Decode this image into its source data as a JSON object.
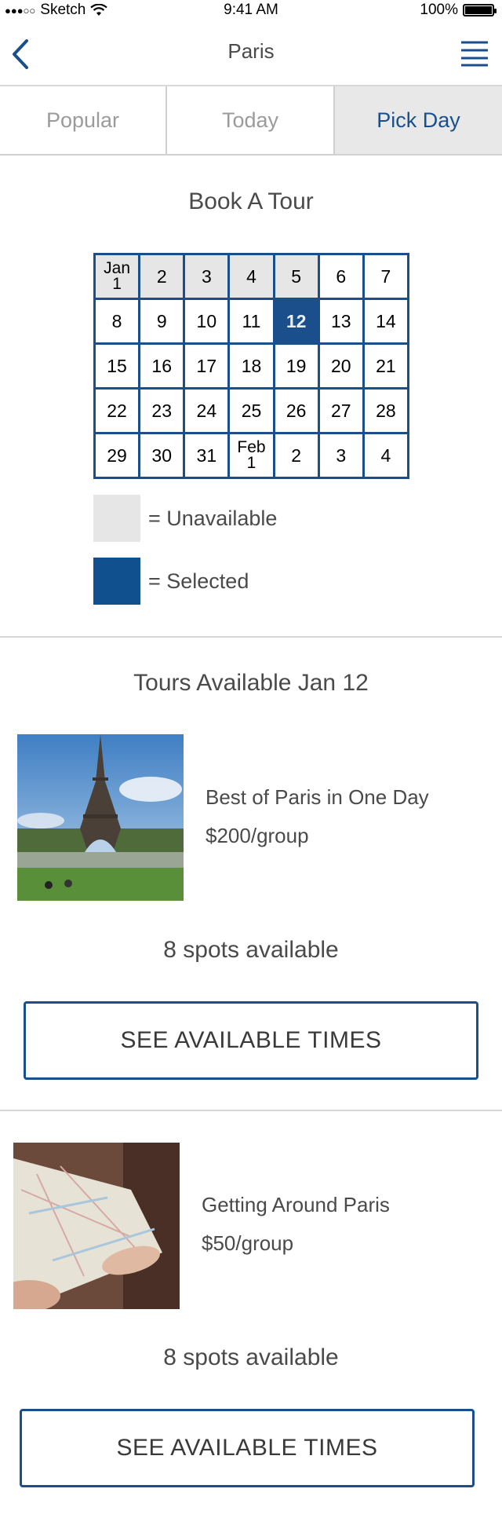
{
  "status": {
    "carrier": "Sketch",
    "time": "9:41 AM",
    "battery": "100%"
  },
  "nav": {
    "title": "Paris"
  },
  "tabs": [
    {
      "label": "Popular"
    },
    {
      "label": "Today"
    },
    {
      "label": "Pick Day",
      "active": true
    }
  ],
  "booking": {
    "title": "Book A Tour",
    "calendar": [
      [
        "Jan\n1",
        "2",
        "3",
        "4",
        "5",
        "6",
        "7"
      ],
      [
        "8",
        "9",
        "10",
        "11",
        "12",
        "13",
        "14"
      ],
      [
        "15",
        "16",
        "17",
        "18",
        "19",
        "20",
        "21"
      ],
      [
        "22",
        "23",
        "24",
        "25",
        "26",
        "27",
        "28"
      ],
      [
        "29",
        "30",
        "31",
        "Feb\n1",
        "2",
        "3",
        "4"
      ]
    ],
    "unavailable": [
      "Jan\n1",
      "2",
      "3",
      "4",
      "5"
    ],
    "selected": "12",
    "legend": {
      "unavailable": "= Unavailable",
      "selected": "= Selected"
    }
  },
  "tours": {
    "title": "Tours Available Jan 12",
    "items": [
      {
        "name": "Best of Paris in One Day",
        "price": "$200/group",
        "spots": "8 spots available",
        "button": "SEE AVAILABLE TIMES"
      },
      {
        "name": "Getting Around Paris",
        "price": "$50/group",
        "spots": "8 spots available",
        "button": "SEE AVAILABLE TIMES"
      }
    ]
  },
  "colors": {
    "accent": "#1a4f8b",
    "unavailable": "#e6e6e6",
    "text": "#4a4a4a"
  }
}
